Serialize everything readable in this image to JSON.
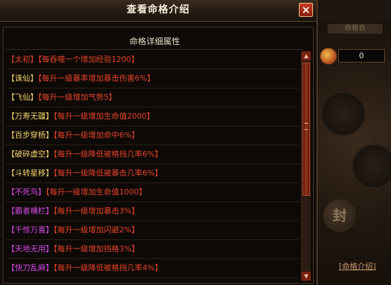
{
  "dialog": {
    "title": "查看命格介绍",
    "close_label": "×",
    "list_header": "命格详细属性"
  },
  "items": [
    {
      "name": "【太初】",
      "desc": "【每吞噬一个增加经验1200】",
      "color": "#e8432a"
    },
    {
      "name": "【诛仙】",
      "desc": "【每升一级暴率增加暴击伤害6%】",
      "color": "#f2d36b"
    },
    {
      "name": "【飞仙】",
      "desc": "【每升一级增加气势5】",
      "color": "#f2d36b"
    },
    {
      "name": "【万寿无疆】",
      "desc": "【每升一级增加生命值2000】",
      "color": "#f2d36b"
    },
    {
      "name": "【百步穿杨】",
      "desc": "【每升一级增加命中6%】",
      "color": "#f2d36b"
    },
    {
      "name": "【破碎虚空】",
      "desc": "【每升一级降低被格挡几率6%】",
      "color": "#f2d36b"
    },
    {
      "name": "【斗转星移】",
      "desc": "【每升一级降低被暴击几率6%】",
      "color": "#f2d36b"
    },
    {
      "name": "【不死鸟】",
      "desc": "【每升一级增加生命值1000】",
      "color": "#d54ae8"
    },
    {
      "name": "【霸者横栏】",
      "desc": "【每升一级增加暴击3%】",
      "color": "#d54ae8"
    },
    {
      "name": "【千惊万喜】",
      "desc": "【每升一级增加闪避2%】",
      "color": "#d54ae8"
    },
    {
      "name": "【天地无用】",
      "desc": "【每升一级增加挡格3%】",
      "color": "#d54ae8"
    },
    {
      "name": "【快刀乱麻】",
      "desc": "【每升一级降低被格挡几率4%】",
      "color": "#d54ae8"
    }
  ],
  "background": {
    "counter_value": "0",
    "top_tab_label": "命格合",
    "seal_glyph": "封",
    "link_label": "[命格介绍]"
  },
  "colors": {
    "name_red": "#e8432a",
    "name_yellow": "#f2d36b",
    "name_purple": "#d54ae8",
    "desc_red": "#e8432a"
  }
}
